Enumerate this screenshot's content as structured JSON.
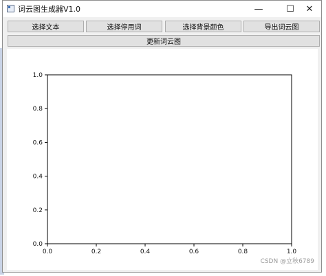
{
  "window": {
    "title": "词云图生成器V1.0",
    "controls": {
      "minimize": "—",
      "maximize": "☐",
      "close": "✕"
    }
  },
  "toolbar": {
    "select_text": "选择文本",
    "select_stopwords": "选择停用词",
    "select_bg_color": "选择背景颜色",
    "export_wordcloud": "导出词云图",
    "update_wordcloud": "更新词云图"
  },
  "chart_data": {
    "type": "line",
    "title": "",
    "xlabel": "",
    "ylabel": "",
    "xlim": [
      0.0,
      1.0
    ],
    "ylim": [
      0.0,
      1.0
    ],
    "xticks": [
      "0.0",
      "0.2",
      "0.4",
      "0.6",
      "0.8",
      "1.0"
    ],
    "yticks": [
      "0.0",
      "0.2",
      "0.4",
      "0.6",
      "0.8",
      "1.0"
    ],
    "grid": false,
    "series": []
  },
  "watermark": "CSDN @立秋6789"
}
